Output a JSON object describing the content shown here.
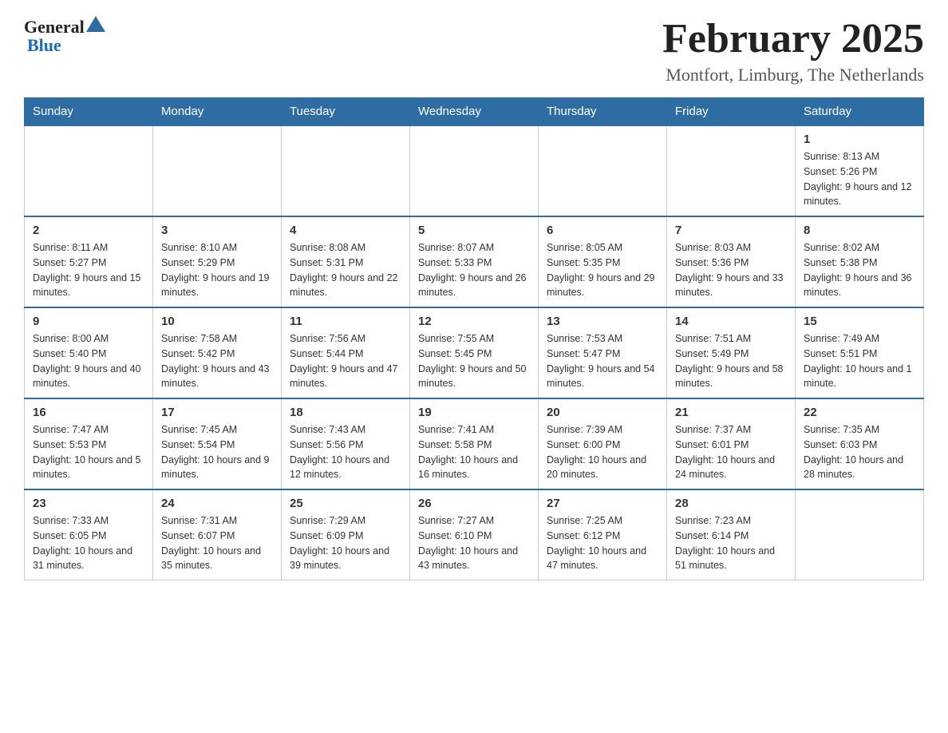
{
  "logo": {
    "text_general": "General",
    "text_blue": "Blue"
  },
  "title": {
    "month_year": "February 2025",
    "location": "Montfort, Limburg, The Netherlands"
  },
  "weekdays": [
    "Sunday",
    "Monday",
    "Tuesday",
    "Wednesday",
    "Thursday",
    "Friday",
    "Saturday"
  ],
  "weeks": [
    {
      "days": [
        {
          "number": "",
          "info": ""
        },
        {
          "number": "",
          "info": ""
        },
        {
          "number": "",
          "info": ""
        },
        {
          "number": "",
          "info": ""
        },
        {
          "number": "",
          "info": ""
        },
        {
          "number": "",
          "info": ""
        },
        {
          "number": "1",
          "info": "Sunrise: 8:13 AM\nSunset: 5:26 PM\nDaylight: 9 hours and 12 minutes."
        }
      ]
    },
    {
      "days": [
        {
          "number": "2",
          "info": "Sunrise: 8:11 AM\nSunset: 5:27 PM\nDaylight: 9 hours and 15 minutes."
        },
        {
          "number": "3",
          "info": "Sunrise: 8:10 AM\nSunset: 5:29 PM\nDaylight: 9 hours and 19 minutes."
        },
        {
          "number": "4",
          "info": "Sunrise: 8:08 AM\nSunset: 5:31 PM\nDaylight: 9 hours and 22 minutes."
        },
        {
          "number": "5",
          "info": "Sunrise: 8:07 AM\nSunset: 5:33 PM\nDaylight: 9 hours and 26 minutes."
        },
        {
          "number": "6",
          "info": "Sunrise: 8:05 AM\nSunset: 5:35 PM\nDaylight: 9 hours and 29 minutes."
        },
        {
          "number": "7",
          "info": "Sunrise: 8:03 AM\nSunset: 5:36 PM\nDaylight: 9 hours and 33 minutes."
        },
        {
          "number": "8",
          "info": "Sunrise: 8:02 AM\nSunset: 5:38 PM\nDaylight: 9 hours and 36 minutes."
        }
      ]
    },
    {
      "days": [
        {
          "number": "9",
          "info": "Sunrise: 8:00 AM\nSunset: 5:40 PM\nDaylight: 9 hours and 40 minutes."
        },
        {
          "number": "10",
          "info": "Sunrise: 7:58 AM\nSunset: 5:42 PM\nDaylight: 9 hours and 43 minutes."
        },
        {
          "number": "11",
          "info": "Sunrise: 7:56 AM\nSunset: 5:44 PM\nDaylight: 9 hours and 47 minutes."
        },
        {
          "number": "12",
          "info": "Sunrise: 7:55 AM\nSunset: 5:45 PM\nDaylight: 9 hours and 50 minutes."
        },
        {
          "number": "13",
          "info": "Sunrise: 7:53 AM\nSunset: 5:47 PM\nDaylight: 9 hours and 54 minutes."
        },
        {
          "number": "14",
          "info": "Sunrise: 7:51 AM\nSunset: 5:49 PM\nDaylight: 9 hours and 58 minutes."
        },
        {
          "number": "15",
          "info": "Sunrise: 7:49 AM\nSunset: 5:51 PM\nDaylight: 10 hours and 1 minute."
        }
      ]
    },
    {
      "days": [
        {
          "number": "16",
          "info": "Sunrise: 7:47 AM\nSunset: 5:53 PM\nDaylight: 10 hours and 5 minutes."
        },
        {
          "number": "17",
          "info": "Sunrise: 7:45 AM\nSunset: 5:54 PM\nDaylight: 10 hours and 9 minutes."
        },
        {
          "number": "18",
          "info": "Sunrise: 7:43 AM\nSunset: 5:56 PM\nDaylight: 10 hours and 12 minutes."
        },
        {
          "number": "19",
          "info": "Sunrise: 7:41 AM\nSunset: 5:58 PM\nDaylight: 10 hours and 16 minutes."
        },
        {
          "number": "20",
          "info": "Sunrise: 7:39 AM\nSunset: 6:00 PM\nDaylight: 10 hours and 20 minutes."
        },
        {
          "number": "21",
          "info": "Sunrise: 7:37 AM\nSunset: 6:01 PM\nDaylight: 10 hours and 24 minutes."
        },
        {
          "number": "22",
          "info": "Sunrise: 7:35 AM\nSunset: 6:03 PM\nDaylight: 10 hours and 28 minutes."
        }
      ]
    },
    {
      "days": [
        {
          "number": "23",
          "info": "Sunrise: 7:33 AM\nSunset: 6:05 PM\nDaylight: 10 hours and 31 minutes."
        },
        {
          "number": "24",
          "info": "Sunrise: 7:31 AM\nSunset: 6:07 PM\nDaylight: 10 hours and 35 minutes."
        },
        {
          "number": "25",
          "info": "Sunrise: 7:29 AM\nSunset: 6:09 PM\nDaylight: 10 hours and 39 minutes."
        },
        {
          "number": "26",
          "info": "Sunrise: 7:27 AM\nSunset: 6:10 PM\nDaylight: 10 hours and 43 minutes."
        },
        {
          "number": "27",
          "info": "Sunrise: 7:25 AM\nSunset: 6:12 PM\nDaylight: 10 hours and 47 minutes."
        },
        {
          "number": "28",
          "info": "Sunrise: 7:23 AM\nSunset: 6:14 PM\nDaylight: 10 hours and 51 minutes."
        },
        {
          "number": "",
          "info": ""
        }
      ]
    }
  ]
}
